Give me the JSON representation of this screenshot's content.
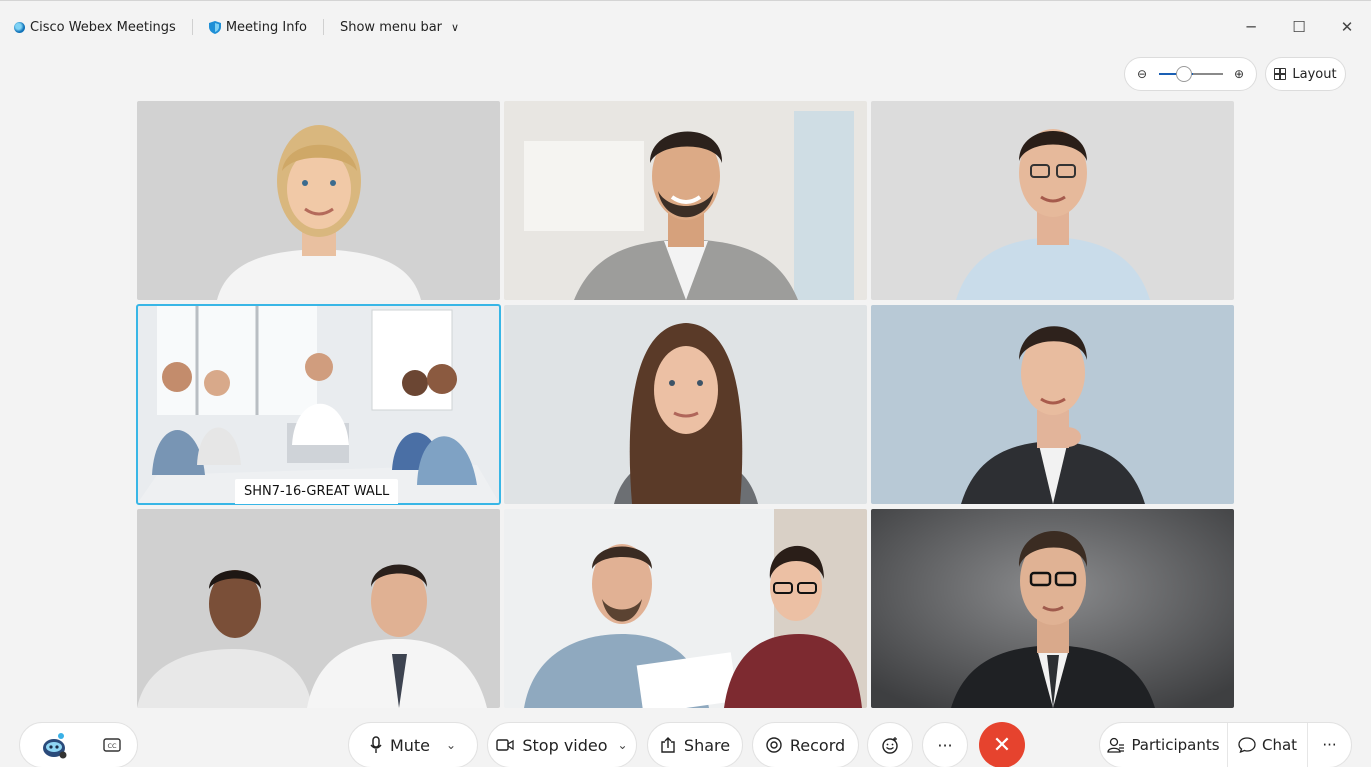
{
  "titlebar": {
    "app_name": "Cisco Webex Meetings",
    "meeting_info": "Meeting Info",
    "menu_toggle": "Show menu bar",
    "minimize": "─",
    "maximize": "☐",
    "close": "✕"
  },
  "view_controls": {
    "zoom_out": "⊖",
    "zoom_in": "⊕",
    "zoom_level": 0.4,
    "layout_label": "Layout"
  },
  "tiles": [
    {
      "kind": "woman-blonde"
    },
    {
      "kind": "man-curly"
    },
    {
      "kind": "man-glasses"
    },
    {
      "kind": "room",
      "name": "SHN7-16-GREAT WALL"
    },
    {
      "kind": "woman-brunette"
    },
    {
      "kind": "man-suit"
    },
    {
      "kind": "two-men"
    },
    {
      "kind": "man-woman"
    },
    {
      "kind": "man-dark"
    }
  ],
  "toolbar": {
    "mute_label": "Mute",
    "stop_video_label": "Stop video",
    "share_label": "Share",
    "record_label": "Record",
    "more_label": "···",
    "end_label": "✕",
    "participants_label": "Participants",
    "chat_label": "Chat",
    "overflow_label": "···"
  },
  "colors": {
    "accent": "#1a5fb4",
    "end_call": "#e6432e",
    "active_speaker": "#38b6e6"
  }
}
